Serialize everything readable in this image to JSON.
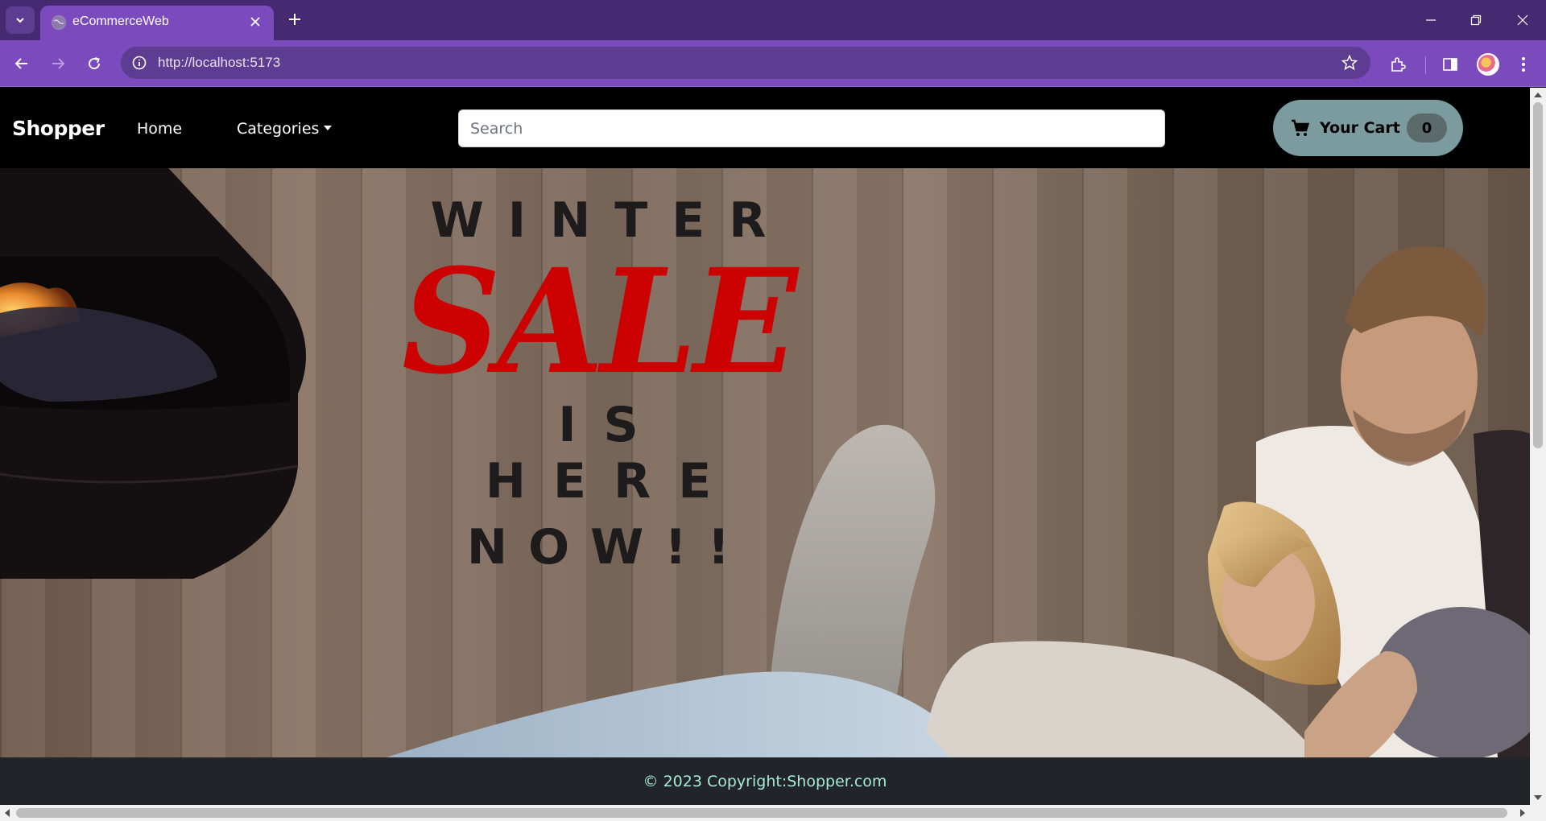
{
  "browser": {
    "tab_title": "eCommerceWeb",
    "url": "http://localhost:5173"
  },
  "navbar": {
    "brand": "Shopper",
    "home_label": "Home",
    "categories_label": "Categories",
    "search_placeholder": "Search",
    "cart_label": "Your Cart",
    "cart_count": "0"
  },
  "hero": {
    "line1": "WINTER",
    "line2": "SALE",
    "line3": "IS HERE",
    "line4": "NOW!!",
    "sale_color": "#cc0000"
  },
  "footer": {
    "text": "© 2023 Copyright:Shopper.com"
  },
  "colors": {
    "tabbar": "#452a72",
    "toolbar": "#7b4bbd",
    "cart_button": "#7b9b9e",
    "footer_bg": "#212529",
    "footer_text": "#a6e9d5"
  }
}
